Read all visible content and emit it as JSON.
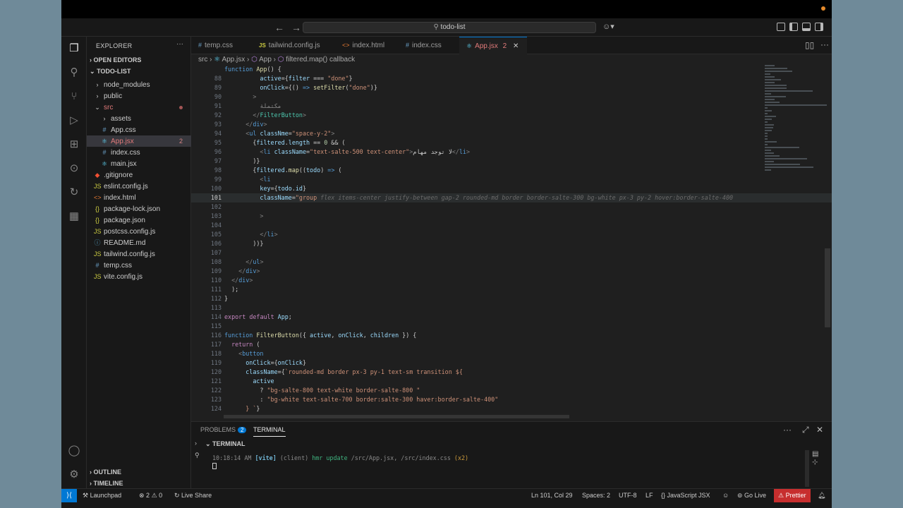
{
  "window": {
    "search_text": "todo-list"
  },
  "sidebar": {
    "title": "EXPLORER",
    "open_editors": "OPEN EDITORS",
    "project": "TODO-LIST",
    "items": [
      {
        "label": "node_modules",
        "icon": "chevron-right-icon",
        "indent": 1
      },
      {
        "label": "public",
        "icon": "chevron-right-icon",
        "indent": 1
      },
      {
        "label": "src",
        "icon": "chevron-down-icon",
        "indent": 1
      },
      {
        "label": "assets",
        "icon": "chevron-right-icon",
        "indent": 2
      },
      {
        "label": "App.css",
        "icon": "css-file-icon",
        "indent": 2
      },
      {
        "label": "App.jsx",
        "icon": "react-file-icon",
        "indent": 2,
        "badge": "2",
        "selected": true
      },
      {
        "label": "index.css",
        "icon": "css-file-icon",
        "indent": 2
      },
      {
        "label": "main.jsx",
        "icon": "react-file-icon",
        "indent": 2
      },
      {
        "label": ".gitignore",
        "icon": "git-file-icon",
        "indent": 1
      },
      {
        "label": "eslint.config.js",
        "icon": "js-file-icon",
        "indent": 1
      },
      {
        "label": "index.html",
        "icon": "html-file-icon",
        "indent": 1
      },
      {
        "label": "package-lock.json",
        "icon": "json-file-icon",
        "indent": 1
      },
      {
        "label": "package.json",
        "icon": "json-file-icon",
        "indent": 1
      },
      {
        "label": "postcss.config.js",
        "icon": "js-file-icon",
        "indent": 1
      },
      {
        "label": "README.md",
        "icon": "info-file-icon",
        "indent": 1
      },
      {
        "label": "tailwind.config.js",
        "icon": "js-file-icon",
        "indent": 1
      },
      {
        "label": "temp.css",
        "icon": "css-file-icon",
        "indent": 1
      },
      {
        "label": "vite.config.js",
        "icon": "js-file-icon",
        "indent": 1
      }
    ],
    "outline": "OUTLINE",
    "timeline": "TIMELINE"
  },
  "tabs": [
    {
      "label": "temp.css",
      "icon": "#"
    },
    {
      "label": "tailwind.config.js",
      "icon": "JS"
    },
    {
      "label": "index.html",
      "icon": "<>"
    },
    {
      "label": "index.css",
      "icon": "#"
    },
    {
      "label": "App.jsx",
      "icon": "⚛",
      "badge": "2",
      "active": true
    }
  ],
  "breadcrumb": {
    "parts": [
      "src",
      "App.jsx",
      "App",
      "filtered.map() callback"
    ]
  },
  "editor": {
    "current_line": "101",
    "lines": [
      {
        "n": "",
        "html": "<span class='k'>function</span> <span class='f'>App</span>() {"
      },
      {
        "n": "88",
        "html": "          <span class='v'>active</span>={<span class='v'>filter</span> === <span class='s'>\"done\"</span>}"
      },
      {
        "n": "89",
        "html": "          <span class='v'>onClick</span>={() <span class='k'>=></span> <span class='f'>setFilter</span>(<span class='s'>\"done\"</span>)}"
      },
      {
        "n": "90",
        "html": "        <span class='p'>></span>"
      },
      {
        "n": "91",
        "html": "          <span style='color:#8a8a8a'>مكتملة</span>"
      },
      {
        "n": "92",
        "html": "        <span class='p'>&lt;/</span><span class='t'>FilterButton</span><span class='p'>></span>"
      },
      {
        "n": "93",
        "html": "      <span class='p'>&lt;/</span><span class='k'>div</span><span class='p'>></span>"
      },
      {
        "n": "94",
        "html": "      <span class='p'>&lt;</span><span class='k'>ul</span> <span class='v'>classNme</span>=<span class='s'>\"space-y-2\"</span><span class='p'>></span>"
      },
      {
        "n": "95",
        "html": "        {<span class='v'>filtered</span>.<span class='v'>length</span> == <span class='n'>0</span> && ("
      },
      {
        "n": "96",
        "html": "          <span class='p'>&lt;</span><span class='k'>li</span> <span class='v'>className</span>=<span class='s'>\"text-salte-500 text-center\"</span><span class='p'>></span>لا توجد مهام<span class='p'>&lt;/</span><span class='k'>li</span><span class='p'>></span>"
      },
      {
        "n": "97",
        "html": "        )}"
      },
      {
        "n": "98",
        "html": "        {<span class='v'>filtered</span>.<span class='f'>map</span>((<span class='v'>todo</span>) <span class='k'>=></span> ("
      },
      {
        "n": "99",
        "html": "          <span class='p'>&lt;</span><span class='k'>li</span>"
      },
      {
        "n": "100",
        "html": "          <span class='v'>key</span>={<span class='v'>todo</span>.<span class='v'>id</span>}"
      },
      {
        "n": "101",
        "html": "          <span class='v'>className</span>=<span class='s'>\"group</span><span class='g'> flex items-center justify-between gap-2 rounded-md border border-salte-300 bg-white px-3 py-2 hover:border-salte-400 </span>"
      },
      {
        "n": "102",
        "html": ""
      },
      {
        "n": "103",
        "html": "          <span class='p'>></span>"
      },
      {
        "n": "104",
        "html": ""
      },
      {
        "n": "105",
        "html": "          <span class='p'>&lt;/</span><span class='k'>li</span><span class='p'>></span>"
      },
      {
        "n": "106",
        "html": "        ))}"
      },
      {
        "n": "107",
        "html": ""
      },
      {
        "n": "108",
        "html": "      <span class='p'>&lt;/</span><span class='k'>ul</span><span class='p'>></span>"
      },
      {
        "n": "109",
        "html": "    <span class='p'>&lt;/</span><span class='k'>div</span><span class='p'>></span>"
      },
      {
        "n": "110",
        "html": "  <span class='p'>&lt;/</span><span class='k'>div</span><span class='p'>></span>"
      },
      {
        "n": "111",
        "html": "  );"
      },
      {
        "n": "112",
        "html": "}"
      },
      {
        "n": "113",
        "html": ""
      },
      {
        "n": "114",
        "html": "<span class='kw'>export</span> <span class='kw'>default</span> <span class='v'>App</span>;"
      },
      {
        "n": "115",
        "html": ""
      },
      {
        "n": "116",
        "html": "<span class='k'>function</span> <span class='f'>FilterButton</span>({ <span class='v'>active</span>, <span class='v'>onClick</span>, <span class='v'>children</span> }) {"
      },
      {
        "n": "117",
        "html": "  <span class='kw'>return</span> ("
      },
      {
        "n": "118",
        "html": "    <span class='p'>&lt;</span><span class='k'>button</span>"
      },
      {
        "n": "119",
        "html": "      <span class='v'>onClick</span>={<span class='v'>onClick</span>}"
      },
      {
        "n": "120",
        "html": "      <span class='v'>className</span>={<span class='s'>`rounded-md border px-3 py-1 text-sm transition ${</span>"
      },
      {
        "n": "121",
        "html": "        <span class='v'>active</span>"
      },
      {
        "n": "122",
        "html": "          ? <span class='s'>\"bg-salte-800 text-white border-salte-800 \"</span>"
      },
      {
        "n": "123",
        "html": "          : <span class='s'>\"bg-white text-salte-700 border:salte-300 haver:border-salte-400\"</span>"
      },
      {
        "n": "124",
        "html": "      <span class='s'>} `</span>}"
      }
    ]
  },
  "panel": {
    "problems": "PROBLEMS",
    "problems_count": "2",
    "terminal_tab": "TERMINAL",
    "terminal_header": "TERMINAL",
    "term_time": "10:18:14 AM",
    "term_vite": "[vite]",
    "term_client": "(client)",
    "term_msg": "hmr update",
    "term_files": "/src/App.jsx, /src/index.css",
    "term_count": "(x2)"
  },
  "status": {
    "launchpad": "Launchpad",
    "errors": "2",
    "warnings": "0",
    "live_share": "Live Share",
    "position": "Ln 101, Col 29",
    "spaces": "Spaces: 2",
    "encoding": "UTF-8",
    "eol": "LF",
    "language": "JavaScript JSX",
    "go_live": "Go Live",
    "prettier": "Prettier"
  }
}
